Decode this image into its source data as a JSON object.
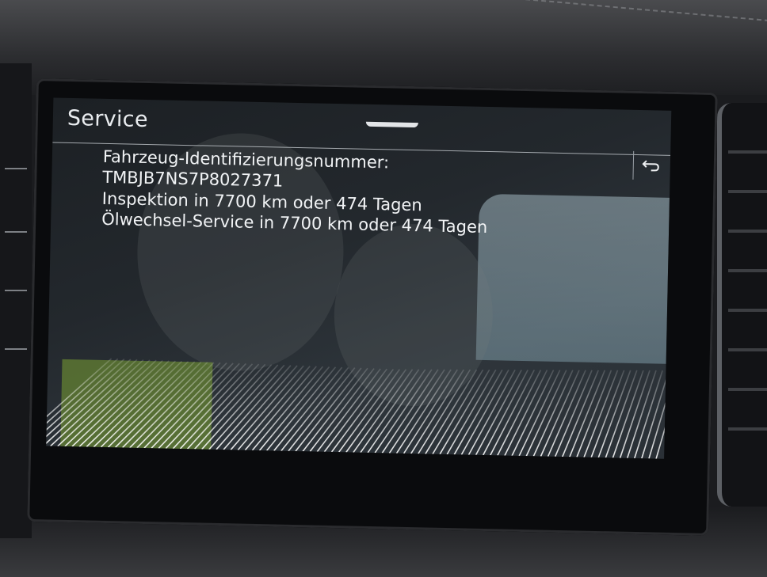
{
  "screen": {
    "title": "Service",
    "back_icon": "back-arrow-icon"
  },
  "info": {
    "vin_label": "Fahrzeug-Identifizierungsnummer:",
    "vin_value": "TMBJB7NS7P8027371",
    "inspection": "Inspektion in 7700 km oder 474 Tagen",
    "oil_service": "Ölwechsel-Service in 7700 km oder 474 Tagen"
  },
  "colors": {
    "text": "#f1f3f5",
    "screen_bg": "#23282d",
    "accent_line": "#c7ccd1"
  }
}
